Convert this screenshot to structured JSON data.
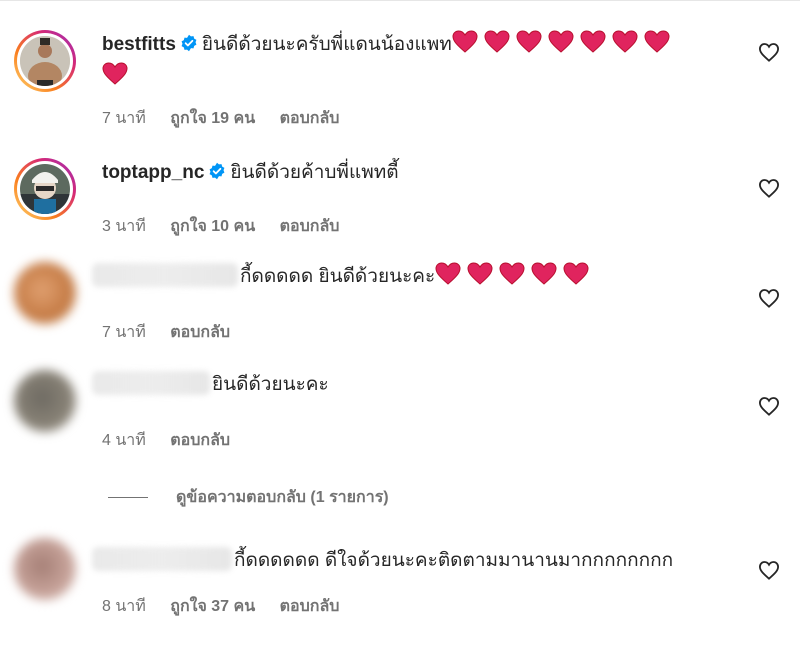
{
  "comments": [
    {
      "username": "bestfitts",
      "verified": true,
      "text": "ยินดีด้วยนะครับพี่แดนน้องแพท",
      "hearts": 8,
      "time": "7 นาที",
      "likes": "ถูกใจ 19 คน",
      "reply": "ตอบกลับ"
    },
    {
      "username": "toptapp_nc",
      "verified": true,
      "text": "ยินดีด้วยค้าบพี่แพทตี้ ",
      "boxes": "",
      "time": "3 นาที",
      "likes": "ถูกใจ 10 คน",
      "reply": "ตอบกลับ"
    },
    {
      "text": "กี้ดดดดด ยินดีด้วยนะคะ",
      "hearts": 5,
      "time": "7 นาที",
      "reply": "ตอบกลับ"
    },
    {
      "text": "ยินดีด้วยนะคะ",
      "time": "4 นาที",
      "reply": "ตอบกลับ"
    },
    {
      "text": "กี้ดดดดดด ดีใจด้วยนะคะติดตามมานานมากกกกกกกก",
      "time": "8 นาที",
      "likes": "ถูกใจ 37 คน",
      "reply": "ตอบกลับ"
    }
  ],
  "view_replies": "ดูข้อความตอบกลับ (1 รายการ)",
  "colors": {
    "text": "#262626",
    "meta": "#737373",
    "verified": "#0095f6",
    "heart": "#e0245e"
  },
  "icons": {
    "like": "heart-outline-icon",
    "verified": "verified-badge-icon",
    "heart_emoji": "red-heart-emoji-icon"
  }
}
